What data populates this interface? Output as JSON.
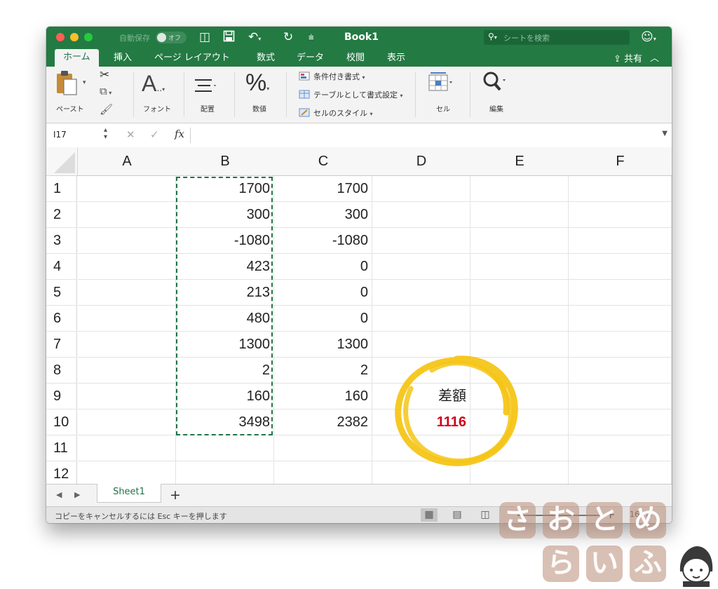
{
  "window": {
    "autosave_label": "自動保存",
    "autosave_state": "オフ",
    "title": "Book1",
    "search_placeholder": "シートを検索"
  },
  "ribbon_tabs": [
    "ホーム",
    "挿入",
    "ページ レイアウト",
    "数式",
    "データ",
    "校閲",
    "表示"
  ],
  "share_label": "共有",
  "ribbon": {
    "paste": "ペースト",
    "font": "フォント",
    "alignment": "配置",
    "number": "数値",
    "conditional_format": "条件付き書式",
    "format_as_table": "テーブルとして書式設定",
    "cell_styles": "セルのスタイル",
    "cells": "セル",
    "editing": "編集"
  },
  "formula_bar": {
    "name_box": "I17",
    "fx": "fx",
    "formula": ""
  },
  "columns": [
    "A",
    "B",
    "C",
    "D",
    "E",
    "F"
  ],
  "rows": [
    {
      "num": "1",
      "B": "1700",
      "C": "1700",
      "D": ""
    },
    {
      "num": "2",
      "B": "300",
      "C": "300",
      "D": ""
    },
    {
      "num": "3",
      "B": "-1080",
      "C": "-1080",
      "D": ""
    },
    {
      "num": "4",
      "B": "423",
      "C": "0",
      "D": ""
    },
    {
      "num": "5",
      "B": "213",
      "C": "0",
      "D": ""
    },
    {
      "num": "6",
      "B": "480",
      "C": "0",
      "D": ""
    },
    {
      "num": "7",
      "B": "1300",
      "C": "1300",
      "D": ""
    },
    {
      "num": "8",
      "B": "2",
      "C": "2",
      "D": ""
    },
    {
      "num": "9",
      "B": "160",
      "C": "160",
      "D": "差額"
    },
    {
      "num": "10",
      "B": "3498",
      "C": "2382",
      "D": "1116"
    },
    {
      "num": "11",
      "B": "",
      "C": "",
      "D": ""
    },
    {
      "num": "12",
      "B": "",
      "C": "",
      "D": ""
    }
  ],
  "sheets": [
    "Sheet1"
  ],
  "status": {
    "message": "コピーをキャンセルするには Esc キーを押します",
    "zoom": "161%"
  },
  "colors": {
    "excel_green": "#217346",
    "result_red": "#d0021b",
    "highlight_yellow": "#f5c518"
  },
  "watermark": [
    "さ",
    "お",
    "と",
    "め",
    "ら",
    "い",
    "ふ"
  ]
}
